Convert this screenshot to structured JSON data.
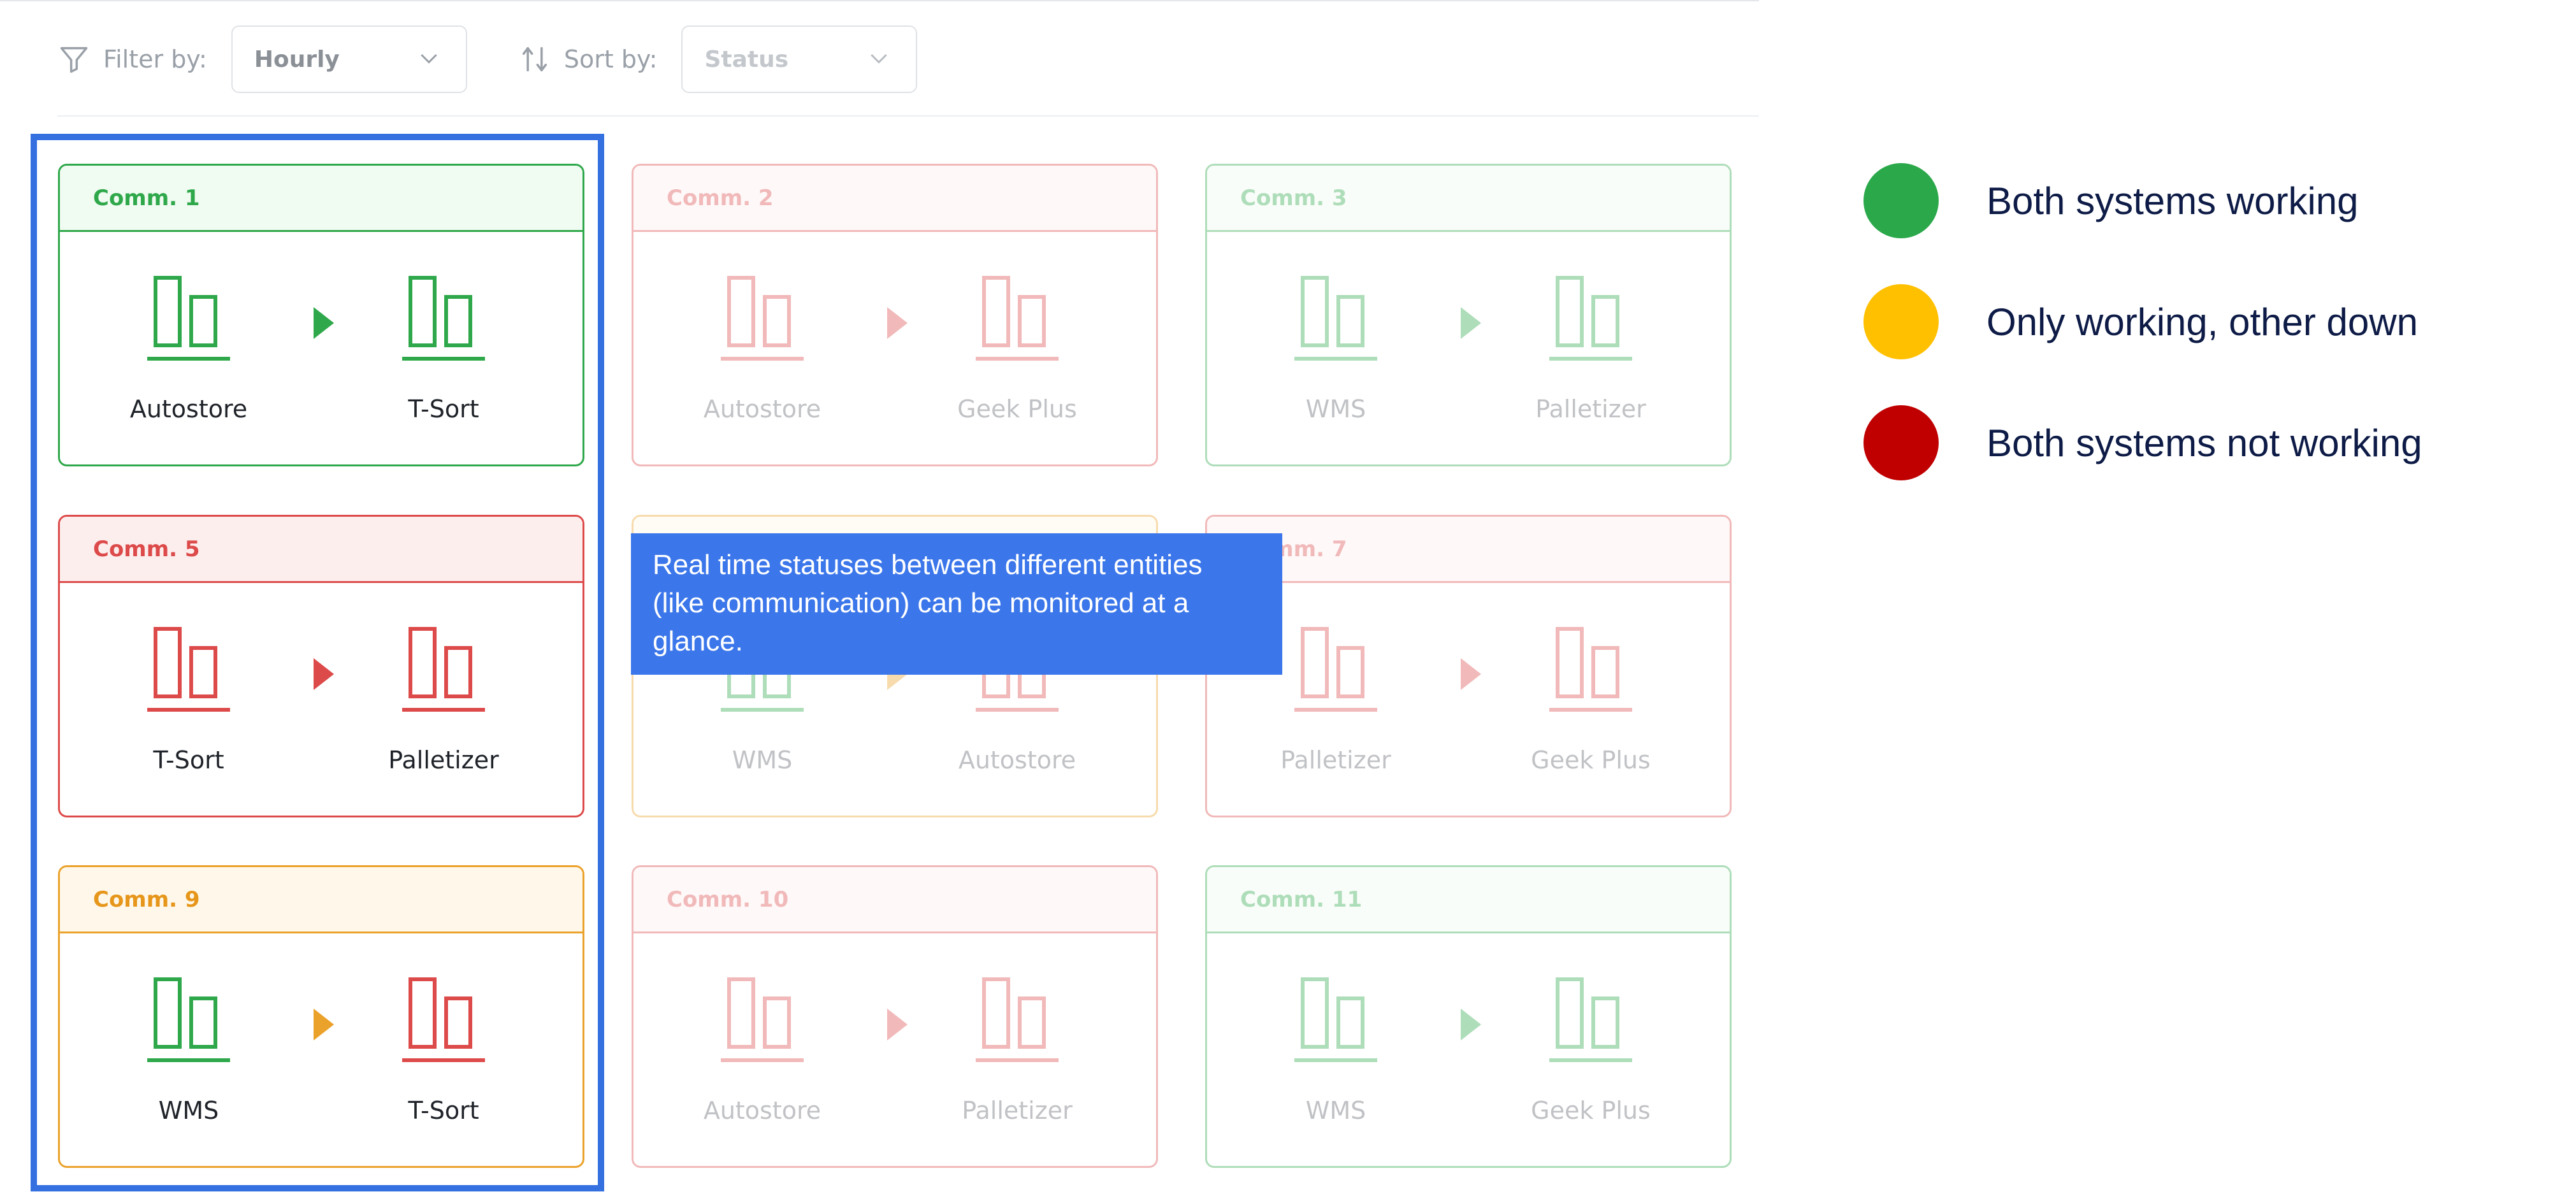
{
  "toolbar": {
    "filter_label": "Filter by:",
    "filter_value": "Hourly",
    "sort_label": "Sort by:",
    "sort_value": "Status"
  },
  "colors": {
    "green": "#2ea84a",
    "red": "#dd4a4a",
    "orange": "#eba22a",
    "highlight": "#3470e0",
    "tooltip_bg": "#3b76ea",
    "legend_green": "#2aa84a",
    "legend_yellow": "#ffc000",
    "legend_red": "#c00000"
  },
  "cards": [
    {
      "title": "Comm. 1",
      "status": "green",
      "dimmed": false,
      "left": {
        "name": "Autostore",
        "status": "green"
      },
      "right": {
        "name": "T-Sort",
        "status": "green"
      }
    },
    {
      "title": "Comm. 2",
      "status": "red",
      "dimmed": true,
      "left": {
        "name": "Autostore",
        "status": "red"
      },
      "right": {
        "name": "Geek Plus",
        "status": "red"
      }
    },
    {
      "title": "Comm. 3",
      "status": "green",
      "dimmed": true,
      "left": {
        "name": "WMS",
        "status": "green"
      },
      "right": {
        "name": "Palletizer",
        "status": "green"
      }
    },
    {
      "title": "Comm. 5",
      "status": "red",
      "dimmed": false,
      "left": {
        "name": "T-Sort",
        "status": "red"
      },
      "right": {
        "name": "Palletizer",
        "status": "red"
      }
    },
    {
      "title": "",
      "status": "orange",
      "dimmed": true,
      "left": {
        "name": "WMS",
        "status": "green"
      },
      "right": {
        "name": "Autostore",
        "status": "red"
      }
    },
    {
      "title": "Comm. 7",
      "status": "red",
      "dimmed": true,
      "left": {
        "name": "Palletizer",
        "status": "red"
      },
      "right": {
        "name": "Geek Plus",
        "status": "red"
      }
    },
    {
      "title": "Comm. 9",
      "status": "orange",
      "dimmed": false,
      "left": {
        "name": "WMS",
        "status": "green"
      },
      "right": {
        "name": "T-Sort",
        "status": "red"
      }
    },
    {
      "title": "Comm. 10",
      "status": "red",
      "dimmed": true,
      "left": {
        "name": "Autostore",
        "status": "red"
      },
      "right": {
        "name": "Palletizer",
        "status": "red"
      }
    },
    {
      "title": "Comm. 11",
      "status": "green",
      "dimmed": true,
      "left": {
        "name": "WMS",
        "status": "green"
      },
      "right": {
        "name": "Geek Plus",
        "status": "green"
      }
    }
  ],
  "tooltip": {
    "text": "Real time statuses between different entities (like communication) can be monitored at a glance."
  },
  "legend": [
    {
      "label": "Both systems working",
      "color": "#2aa84a"
    },
    {
      "label": "Only working, other down",
      "color": "#ffc000"
    },
    {
      "label": "Both systems not working",
      "color": "#c00000"
    }
  ]
}
